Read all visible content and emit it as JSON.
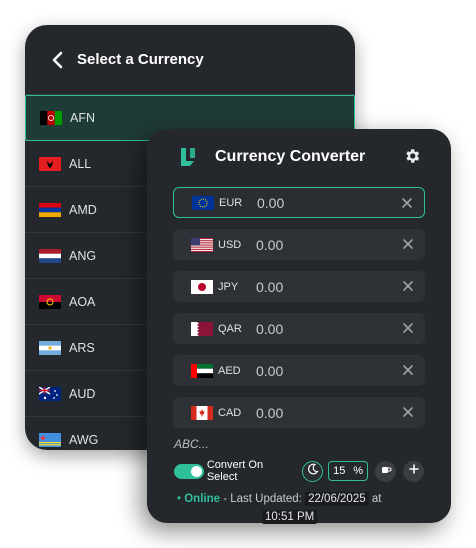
{
  "select_panel": {
    "title": "Select a Currency",
    "items": [
      {
        "code": "AFN",
        "flag": "afghanistan-flag"
      },
      {
        "code": "ALL",
        "flag": "albania-flag"
      },
      {
        "code": "AMD",
        "flag": "armenia-flag"
      },
      {
        "code": "ANG",
        "flag": "netherlands-flag"
      },
      {
        "code": "AOA",
        "flag": "angola-flag"
      },
      {
        "code": "ARS",
        "flag": "argentina-flag"
      },
      {
        "code": "AUD",
        "flag": "australia-flag"
      },
      {
        "code": "AWG",
        "flag": "aruba-flag"
      }
    ],
    "selected": "AFN"
  },
  "converter": {
    "title": "Currency Converter",
    "rows": [
      {
        "code": "EUR",
        "amount": "0.00",
        "flag": "eu-flag"
      },
      {
        "code": "USD",
        "amount": "0.00",
        "flag": "us-flag"
      },
      {
        "code": "JPY",
        "amount": "0.00",
        "flag": "japan-flag"
      },
      {
        "code": "QAR",
        "amount": "0.00",
        "flag": "qatar-flag"
      },
      {
        "code": "AED",
        "amount": "0.00",
        "flag": "uae-flag"
      },
      {
        "code": "CAD",
        "amount": "0.00",
        "flag": "canada-flag"
      }
    ],
    "add_placeholder": "ABC...",
    "convert_on_select_label": "Convert On Select",
    "convert_on_select": true,
    "percent_value": "15",
    "percent_symbol": "%",
    "status": {
      "online": "Online",
      "last_updated_label": "- Last Updated:",
      "date": "22/06/2025",
      "at": "at",
      "time": "10:51 PM"
    }
  },
  "colors": {
    "panel_bg": "#24272c",
    "row_bg": "#2e3136",
    "accent": "#2fbf9a",
    "text": "#e8eaed"
  }
}
